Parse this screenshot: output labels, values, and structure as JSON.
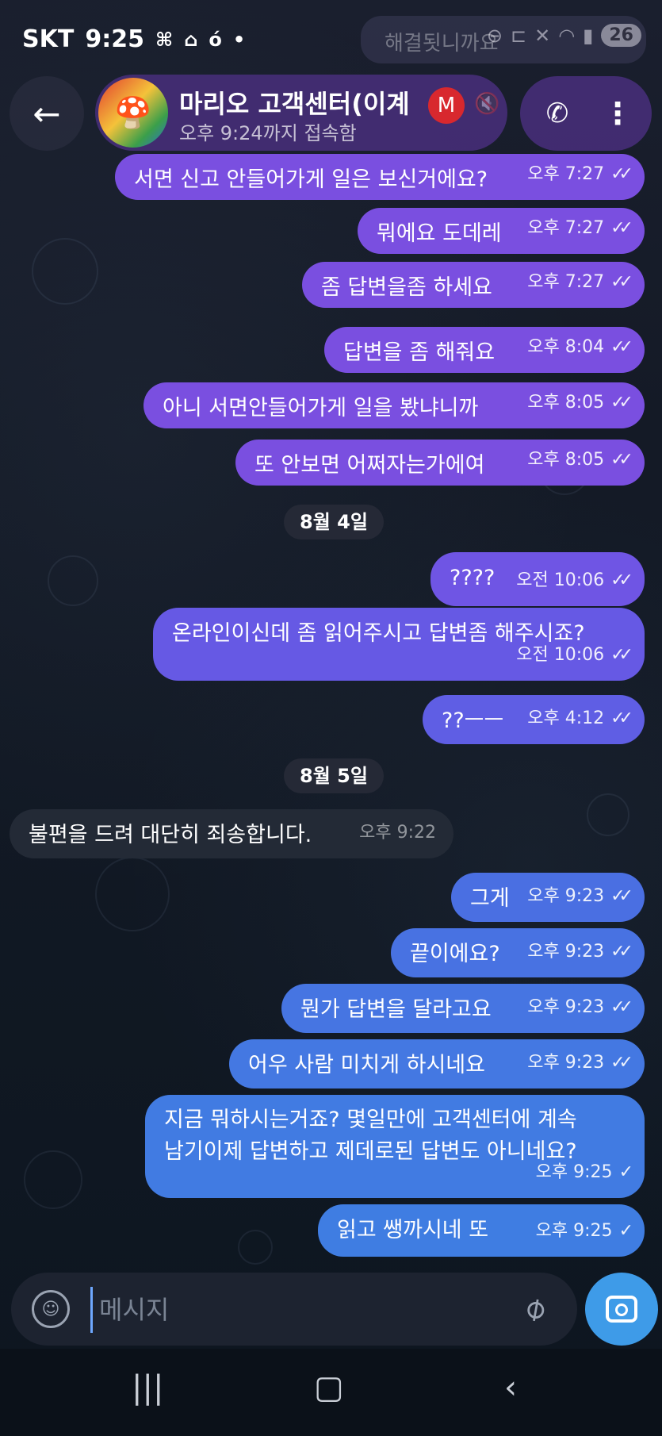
{
  "statusbar": {
    "carrier": "SKT",
    "time": "9:25",
    "battery": "26"
  },
  "ghost_message": "해결됫니까요",
  "header": {
    "title": "마리오 고객센터(이계",
    "status": "오후 9:24까지 접속함"
  },
  "dates": {
    "aug4": "8월 4일",
    "aug5": "8월 5일"
  },
  "messages": [
    {
      "text": "서면 신고 안들어가게 일은 보신거에요?",
      "time": "오후 7:27"
    },
    {
      "text": "뭐에요 도데레",
      "time": "오후 7:27"
    },
    {
      "text": "좀 답변을좀 하세요",
      "time": "오후 7:27"
    },
    {
      "text": "답변을 좀 해줘요",
      "time": "오후 8:04"
    },
    {
      "text": "아니 서면안들어가게 일을 봤냐니까",
      "time": "오후 8:05"
    },
    {
      "text": "또 안보면 어쩌자는가에여",
      "time": "오후 8:05"
    },
    {
      "text": "????",
      "time": "오전 10:06"
    },
    {
      "text": "온라인이신데 좀 읽어주시고 답변좀 해주시죠?",
      "time": "오전 10:06"
    },
    {
      "text": "??ㅡㅡ",
      "time": "오후 4:12"
    },
    {
      "text": "불편을 드려 대단히 죄송합니다.",
      "time": "오후 9:22"
    },
    {
      "text": "그게",
      "time": "오후 9:23"
    },
    {
      "text": "끝이에요?",
      "time": "오후 9:23"
    },
    {
      "text": "뭔가 답변을 달라고요",
      "time": "오후 9:23"
    },
    {
      "text": "어우 사람 미치게 하시네요",
      "time": "오후 9:23"
    },
    {
      "text_line1": "지금 뭐하시는거죠? 몇일만에 고객센터에 계속",
      "text_line2": "남기이제 답변하고 제데로된 답변도 아니네요?",
      "time": "오후 9:25"
    },
    {
      "text": "읽고 쌩까시네 또",
      "time": "오후 9:25"
    }
  ],
  "input": {
    "placeholder": "메시지"
  },
  "colors": {
    "outgoing_purple": "#7a4fe0",
    "outgoing_blue": "#3f7be0",
    "incoming": "#232a36",
    "accent": "#3e9be8"
  }
}
